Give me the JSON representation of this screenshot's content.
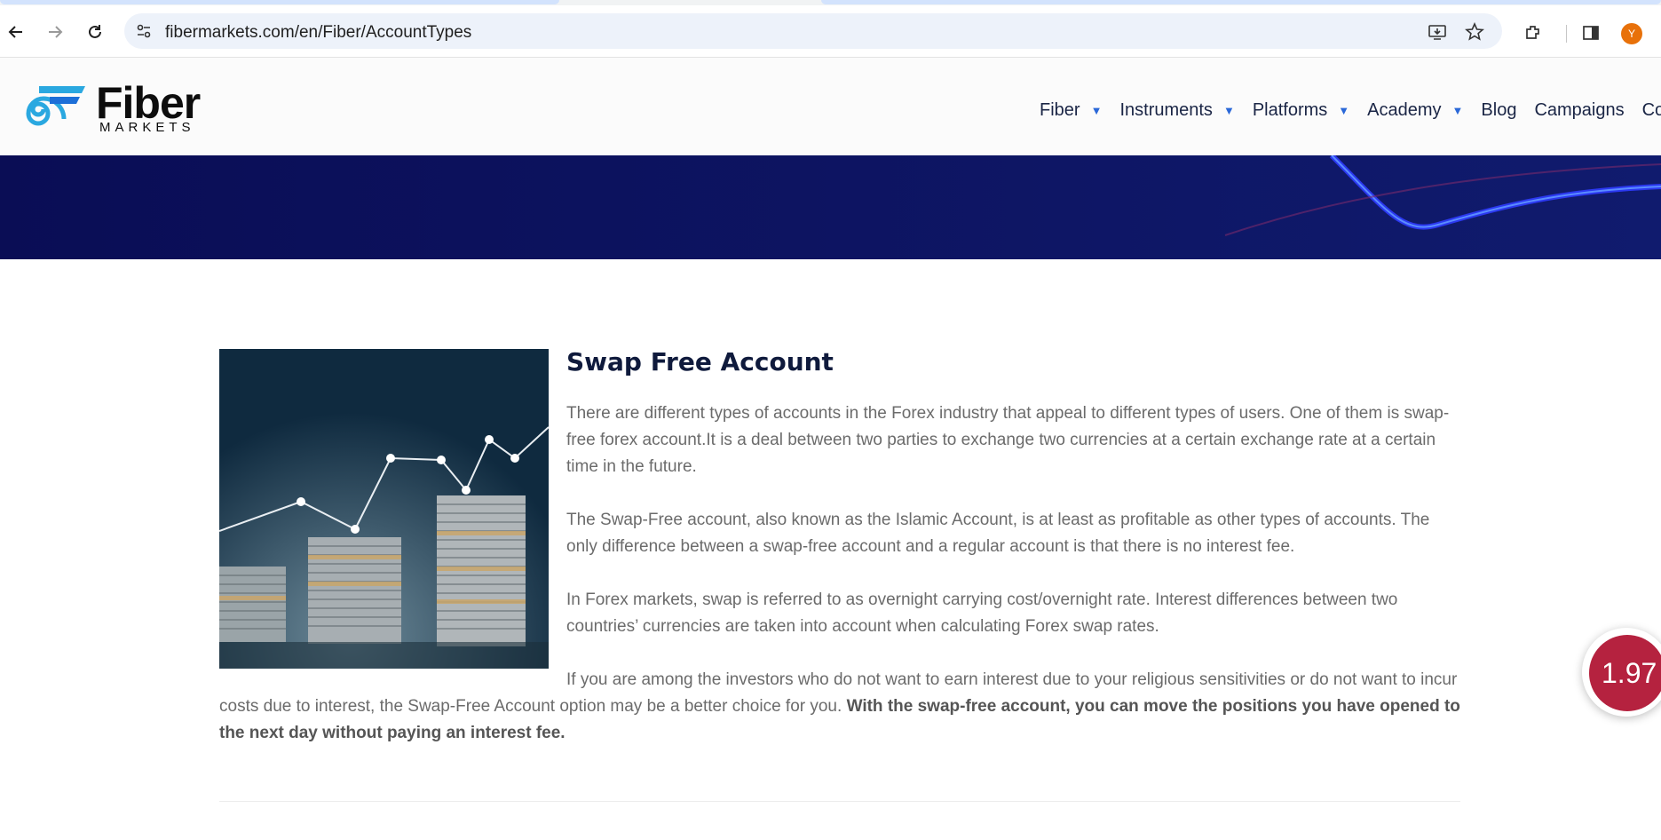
{
  "browser": {
    "url": "fibermarkets.com/en/Fiber/AccountTypes",
    "profile_initial": "Y",
    "accent": "#d3e3fd"
  },
  "site": {
    "logo_word": "Fiber",
    "logo_sub": "MARKETS",
    "nav": [
      {
        "label": "Fiber",
        "has_dropdown": true
      },
      {
        "label": "Instruments",
        "has_dropdown": true
      },
      {
        "label": "Platforms",
        "has_dropdown": true
      },
      {
        "label": "Academy",
        "has_dropdown": true
      },
      {
        "label": "Blog",
        "has_dropdown": false
      },
      {
        "label": "Campaigns",
        "has_dropdown": false
      },
      {
        "label": "Contact",
        "has_dropdown": false
      }
    ],
    "banner_color": "#0b0f5e"
  },
  "article": {
    "title": "Swap Free Account",
    "p1": "There are different types of accounts in the Forex industry that appeal to different types of users. One of them is swap-free forex account.It is a deal between two parties to exchange two currencies at a certain exchange rate at a certain time in the future.",
    "p2": "The Swap-Free account, also known as the Islamic Account, is at least as profitable as other types of accounts. The only difference between a swap-free account and a regular account is that there is no interest fee.",
    "p3": "In Forex markets, swap is referred to as overnight carrying cost/overnight rate. Interest differences between two countries’ currencies are taken into account when calculating Forex swap rates.",
    "p4_plain": "If you are among the investors who do not want to earn interest due to your religious sensitivities or do not want to incur costs due to interest, the Swap-Free Account option may be a better choice for you. ",
    "p4_bold": "With the swap-free account, you can move the positions you have opened to the next day without paying an interest fee."
  },
  "widget": {
    "value": "1.97",
    "color": "#b5223f"
  }
}
